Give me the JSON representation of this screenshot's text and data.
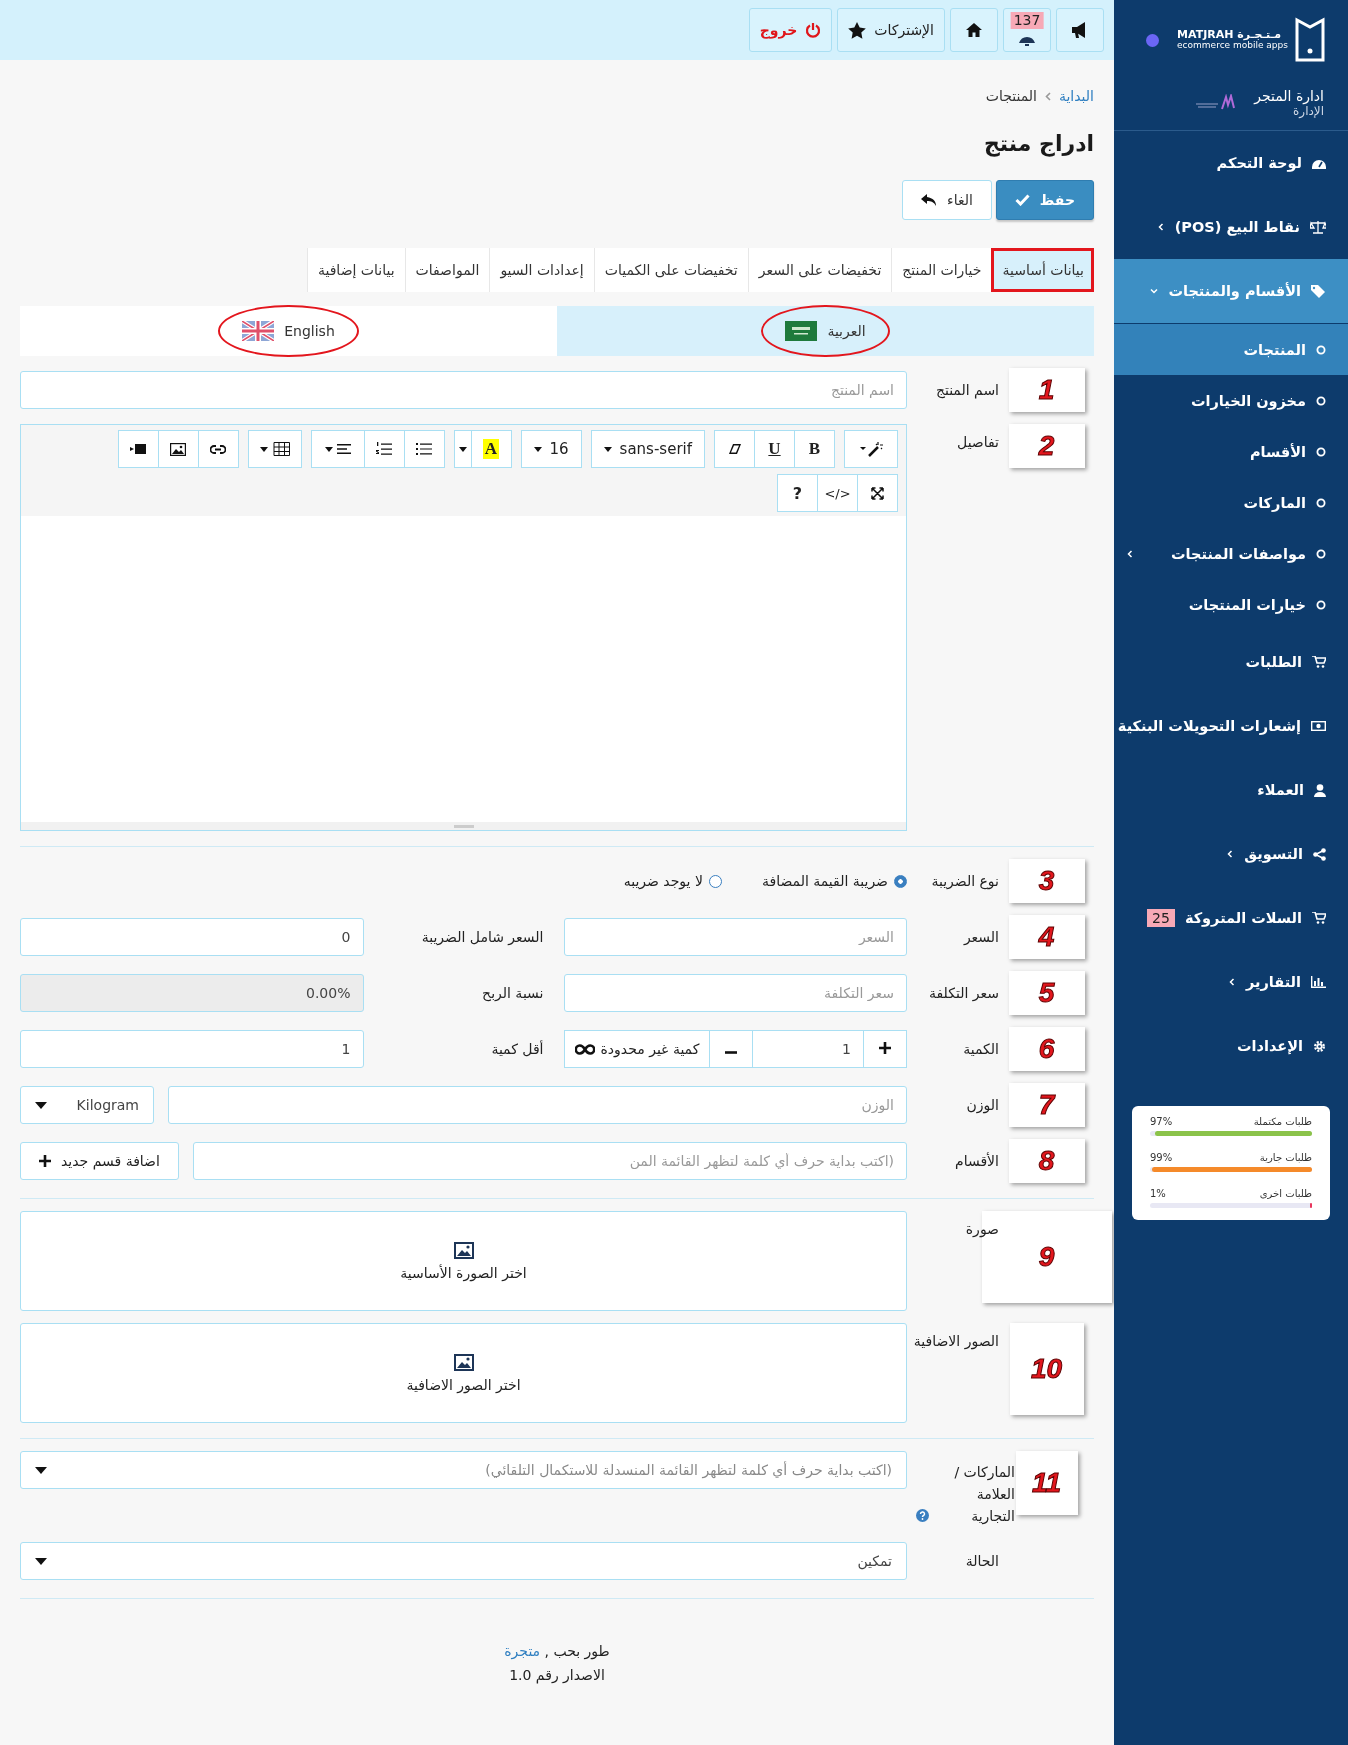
{
  "topbar": {
    "buttons": [
      {
        "kind": "announcements"
      },
      {
        "kind": "notifications",
        "badge": "137"
      },
      {
        "kind": "home"
      },
      {
        "kind": "subscriptions",
        "label": "الإشتركات"
      },
      {
        "kind": "logout",
        "label": "خروج"
      }
    ]
  },
  "sidebar": {
    "logo": {
      "arabic": "مـتـجـرة",
      "latin": "MATJRAH",
      "tagline": "ecommerce mobile apps"
    },
    "store": {
      "title": "ادارة المتجر",
      "subtitle": "الإدارة"
    },
    "items": [
      {
        "kind": "dashboard",
        "label": "لوحة التحكم",
        "selected": false,
        "has_submenu": false
      },
      {
        "kind": "scale",
        "label": "نقاط البيع (POS)",
        "selected": false,
        "has_submenu": true,
        "expanded": false
      },
      {
        "kind": "tag",
        "label": "الأقسام والمنتجات",
        "selected": true,
        "has_submenu": true,
        "expanded": true,
        "children": [
          {
            "label": "المنتجات",
            "selected": true,
            "has_submenu": false
          },
          {
            "label": "مخزون الخيارات",
            "selected": false,
            "has_submenu": false
          },
          {
            "label": "الأقسام",
            "selected": false,
            "has_submenu": false
          },
          {
            "label": "الماركات",
            "selected": false,
            "has_submenu": false
          },
          {
            "label": "مواصفات المنتجات",
            "selected": false,
            "has_submenu": true
          },
          {
            "label": "خيارات المنتجات",
            "selected": false,
            "has_submenu": false
          }
        ]
      },
      {
        "kind": "cart",
        "label": "الطلبات",
        "selected": false,
        "has_submenu": false
      },
      {
        "kind": "money",
        "label": "إشعارات التحويلات البنكية",
        "selected": false,
        "has_submenu": false
      },
      {
        "kind": "user",
        "label": "العملاء",
        "selected": false,
        "has_submenu": false
      },
      {
        "kind": "share",
        "label": "التسويق",
        "selected": false,
        "has_submenu": true,
        "expanded": false
      },
      {
        "kind": "cart",
        "label": "السلات المتروكة",
        "selected": false,
        "has_submenu": false,
        "badge": "25"
      },
      {
        "kind": "chart",
        "label": "التقارير",
        "selected": false,
        "has_submenu": true,
        "expanded": false
      },
      {
        "kind": "gear",
        "label": "الإعدادات",
        "selected": false,
        "has_submenu": false
      }
    ],
    "stats": [
      {
        "label": "طلبات مكتملة",
        "value": "97%",
        "level": 0.97,
        "color": "#8bc34a"
      },
      {
        "label": "طلبات جارية",
        "value": "99%",
        "level": 0.99,
        "color": "#f58a2a"
      },
      {
        "label": "طلبات اخرى",
        "value": "1%",
        "level": 0.01,
        "color": "#e8365d"
      }
    ]
  },
  "breadcrumb": [
    {
      "label": "البداية",
      "link": true
    },
    {
      "label": "المنتجات",
      "link": false
    }
  ],
  "title": "ادراج منتج",
  "actions": [
    {
      "kind": "save",
      "label": "حفظ"
    },
    {
      "kind": "cancel",
      "label": "الغاء"
    }
  ],
  "tabs": [
    {
      "label": "بيانات أساسية",
      "selected": true,
      "annotated": true
    },
    {
      "label": "خيارات المنتج",
      "selected": false,
      "annotated": false
    },
    {
      "label": "تخفيضات على السعر",
      "selected": false,
      "annotated": false
    },
    {
      "label": "تخفيضات على الكميات",
      "selected": false,
      "annotated": false
    },
    {
      "label": "إعدادات السيو",
      "selected": false,
      "annotated": false
    },
    {
      "label": "المواصفات",
      "selected": false,
      "annotated": false
    },
    {
      "label": "بيانات إضافية",
      "selected": false,
      "annotated": false
    }
  ],
  "languages": [
    {
      "kind": "ar",
      "label": "العربية",
      "selected": true,
      "annotated": true
    },
    {
      "kind": "en",
      "label": "English",
      "selected": false,
      "annotated": true
    }
  ],
  "name": {
    "marker": "1",
    "label": "اسم المنتج",
    "placeholder": "اسم المنتج"
  },
  "details": {
    "marker": "2",
    "label": "تفاصيل",
    "font": "sans-serif",
    "size": "16",
    "color_button": "A",
    "bold": "B",
    "underline": "U",
    "help": "?",
    "code": "</>"
  },
  "tax": {
    "marker": "3",
    "label": "نوع الضريبة",
    "options": [
      {
        "label": "ضريبة القيمة المضافة",
        "selected": true
      },
      {
        "label": "لا يوجد ضريبه",
        "selected": false
      }
    ]
  },
  "price": {
    "marker": "4",
    "label": "السعر",
    "placeholder": "السعر",
    "total_label": "السعر شامل الضريبة",
    "total_value": "0"
  },
  "cost": {
    "marker": "5",
    "label": "سعر التكلفة",
    "placeholder": "سعر التكلفة",
    "profit_label": "نسبة الربح",
    "profit_value": "0.00%",
    "profit_disabled": true
  },
  "quantity": {
    "marker": "6",
    "label": "الكمية",
    "value": "1",
    "unlimited": "كمية غير محدودة",
    "min_label": "أقل كمية",
    "min_value": "1"
  },
  "weight": {
    "marker": "7",
    "label": "الوزن",
    "placeholder": "الوزن",
    "unit": "Kilogram"
  },
  "categories": {
    "marker": "8",
    "label": "الأقسام",
    "placeholder": "(اكتب بداية حرف أي كلمة لتظهر القائمة المن",
    "add_button": "اضافة قسم جديد"
  },
  "image": {
    "marker": "9",
    "label": "صورة",
    "button": "اختر الصورة الأساسية"
  },
  "extra_images": {
    "marker": "10",
    "label": "الصور الاضافية",
    "button": "اختر الصور الاضافية"
  },
  "brands": {
    "marker": "11",
    "label": "الماركات / العلامة التجارية",
    "placeholder": "(اكتب بداية حرف أي كلمة لتظهر القائمة المنسدلة للاستكمال التلقائي)"
  },
  "status": {
    "label": "الحالة",
    "value": "تمكين"
  },
  "footer": {
    "credit": "طور بحب ,",
    "link": "متجرة",
    "version": "الاصدار رقم 1.0"
  }
}
